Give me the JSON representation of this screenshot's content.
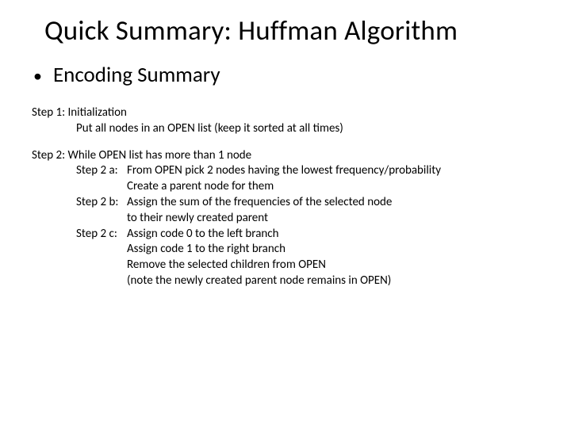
{
  "title": "Quick Summary: Huffman Algorithm",
  "bullet": "Encoding Summary",
  "step1": {
    "head": "Step 1: Initialization",
    "line1": "Put all nodes in an OPEN list (keep it sorted at all times)"
  },
  "step2": {
    "head": "Step 2: While OPEN list has more than 1 node",
    "a_label": "Step 2 a:",
    "a_line1": "From OPEN pick 2 nodes having the lowest frequency/probability",
    "a_line2": "Create a parent node for them",
    "b_label": "Step 2 b:",
    "b_line1": "Assign the sum of the frequencies of the selected node",
    "b_line2": "to their newly created parent",
    "c_label": "Step 2 c:",
    "c_line1": "Assign code 0 to the left branch",
    "c_line2": "Assign code 1 to the right branch",
    "c_line3": "Remove the selected children from OPEN",
    "c_line4": "(note the newly created parent node remains in OPEN)"
  }
}
